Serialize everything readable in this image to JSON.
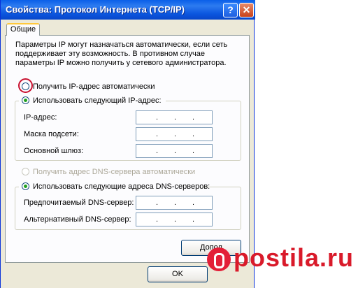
{
  "window": {
    "title": "Свойства: Протокол Интернета (TCP/IP)",
    "help_glyph": "?",
    "close_glyph": "✕"
  },
  "tab": {
    "label": "Общие"
  },
  "description": "Параметры IP могут назначаться автоматически, если сеть поддерживает эту возможность. В противном случае параметры IP можно получить у сетевого администратора.",
  "ip": {
    "auto_label": "Получить IP-адрес автоматически",
    "manual_label": "Использовать следующий IP-адрес:",
    "fields": [
      {
        "label": "IP-адрес:"
      },
      {
        "label": "Маска подсети:"
      },
      {
        "label": "Основной шлюз:"
      }
    ]
  },
  "dns": {
    "auto_label": "Получить адрес DNS-сервера автоматически",
    "manual_label": "Использовать следующие адреса DNS-серверов:",
    "fields": [
      {
        "label": "Предпочитаемый DNS-сервер:"
      },
      {
        "label": "Альтернативный DNS-сервер:"
      }
    ]
  },
  "buttons": {
    "advanced": "Допол",
    "ok": "OK"
  },
  "watermark": {
    "text": "postila.ru"
  },
  "colors": {
    "accent": "#0a5fe8",
    "highlight_circle": "#c8102e",
    "watermark": "#d91a2a"
  }
}
